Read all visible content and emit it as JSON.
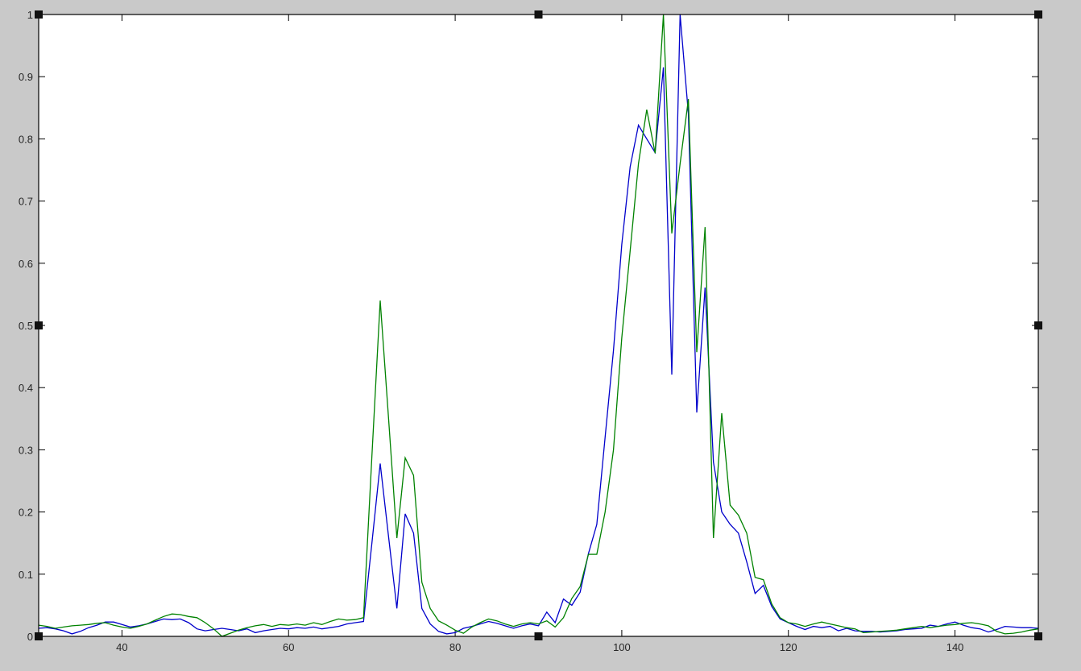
{
  "window": {
    "background_color": "#c9c9c9",
    "plot_background": "#ffffff",
    "axis_color": "#000000",
    "tick_label_color": "#262626",
    "selection_handle_color": "#111111"
  },
  "chart_data": {
    "type": "line",
    "title": "",
    "xlabel": "",
    "ylabel": "",
    "xlim": [
      30,
      150
    ],
    "ylim": [
      0,
      1
    ],
    "grid": false,
    "legend_position": "none",
    "box": true,
    "ticks_direction": "in",
    "x_ticks": [
      40,
      60,
      80,
      100,
      120,
      140
    ],
    "x_tick_labels": [
      "40",
      "60",
      "80",
      "100",
      "120",
      "140"
    ],
    "y_ticks": [
      0,
      0.1,
      0.2,
      0.3,
      0.4,
      0.5,
      0.6,
      0.7,
      0.8,
      0.9,
      1
    ],
    "y_tick_labels": [
      "0",
      "0.1",
      "0.2",
      "0.3",
      "0.4",
      "0.5",
      "0.6",
      "0.7",
      "0.8",
      "0.9",
      "1"
    ],
    "selection_handles": true,
    "series": [
      {
        "name": "blue-line",
        "color": "#0000cb",
        "points": [
          [
            30,
            0.013
          ],
          [
            31,
            0.014
          ],
          [
            32,
            0.012
          ],
          [
            33,
            0.009
          ],
          [
            34,
            0.004
          ],
          [
            35,
            0.008
          ],
          [
            36,
            0.014
          ],
          [
            37,
            0.018
          ],
          [
            38,
            0.023
          ],
          [
            39,
            0.023
          ],
          [
            40,
            0.019
          ],
          [
            41,
            0.015
          ],
          [
            42,
            0.017
          ],
          [
            43,
            0.02
          ],
          [
            44,
            0.024
          ],
          [
            45,
            0.028
          ],
          [
            46,
            0.027
          ],
          [
            47,
            0.028
          ],
          [
            48,
            0.022
          ],
          [
            49,
            0.012
          ],
          [
            50,
            0.009
          ],
          [
            51,
            0.011
          ],
          [
            52,
            0.013
          ],
          [
            53,
            0.011
          ],
          [
            54,
            0.009
          ],
          [
            55,
            0.012
          ],
          [
            56,
            0.006
          ],
          [
            57,
            0.009
          ],
          [
            58,
            0.011
          ],
          [
            59,
            0.013
          ],
          [
            60,
            0.012
          ],
          [
            61,
            0.014
          ],
          [
            62,
            0.013
          ],
          [
            63,
            0.015
          ],
          [
            64,
            0.012
          ],
          [
            65,
            0.014
          ],
          [
            66,
            0.016
          ],
          [
            67,
            0.02
          ],
          [
            68,
            0.022
          ],
          [
            69,
            0.024
          ],
          [
            70,
            0.15
          ],
          [
            71,
            0.278
          ],
          [
            72,
            0.16
          ],
          [
            73,
            0.045
          ],
          [
            74,
            0.197
          ],
          [
            75,
            0.166
          ],
          [
            76,
            0.045
          ],
          [
            77,
            0.02
          ],
          [
            78,
            0.008
          ],
          [
            79,
            0.004
          ],
          [
            80,
            0.006
          ],
          [
            81,
            0.013
          ],
          [
            82,
            0.016
          ],
          [
            83,
            0.02
          ],
          [
            84,
            0.024
          ],
          [
            85,
            0.021
          ],
          [
            86,
            0.017
          ],
          [
            87,
            0.013
          ],
          [
            88,
            0.017
          ],
          [
            89,
            0.02
          ],
          [
            90,
            0.017
          ],
          [
            91,
            0.039
          ],
          [
            92,
            0.022
          ],
          [
            93,
            0.06
          ],
          [
            94,
            0.05
          ],
          [
            95,
            0.071
          ],
          [
            96,
            0.133
          ],
          [
            97,
            0.18
          ],
          [
            98,
            0.32
          ],
          [
            99,
            0.46
          ],
          [
            100,
            0.63
          ],
          [
            101,
            0.755
          ],
          [
            102,
            0.822
          ],
          [
            103,
            0.8
          ],
          [
            104,
            0.778
          ],
          [
            105,
            0.915
          ],
          [
            106,
            0.421
          ],
          [
            107,
            1.0
          ],
          [
            108,
            0.84
          ],
          [
            109,
            0.36
          ],
          [
            110,
            0.561
          ],
          [
            111,
            0.28
          ],
          [
            112,
            0.2
          ],
          [
            113,
            0.18
          ],
          [
            114,
            0.166
          ],
          [
            115,
            0.12
          ],
          [
            116,
            0.069
          ],
          [
            117,
            0.082
          ],
          [
            118,
            0.048
          ],
          [
            119,
            0.028
          ],
          [
            120,
            0.022
          ],
          [
            121,
            0.016
          ],
          [
            122,
            0.011
          ],
          [
            123,
            0.016
          ],
          [
            124,
            0.014
          ],
          [
            125,
            0.016
          ],
          [
            126,
            0.009
          ],
          [
            127,
            0.013
          ],
          [
            128,
            0.009
          ],
          [
            129,
            0.008
          ],
          [
            130,
            0.008
          ],
          [
            131,
            0.007
          ],
          [
            132,
            0.008
          ],
          [
            133,
            0.009
          ],
          [
            134,
            0.011
          ],
          [
            135,
            0.012
          ],
          [
            136,
            0.013
          ],
          [
            137,
            0.018
          ],
          [
            138,
            0.016
          ],
          [
            139,
            0.02
          ],
          [
            140,
            0.023
          ],
          [
            141,
            0.018
          ],
          [
            142,
            0.014
          ],
          [
            143,
            0.012
          ],
          [
            144,
            0.007
          ],
          [
            145,
            0.011
          ],
          [
            146,
            0.016
          ],
          [
            147,
            0.015
          ],
          [
            148,
            0.014
          ],
          [
            149,
            0.014
          ],
          [
            150,
            0.013
          ]
        ]
      },
      {
        "name": "green-line",
        "color": "#008200",
        "points": [
          [
            30,
            0.018
          ],
          [
            31,
            0.016
          ],
          [
            32,
            0.013
          ],
          [
            33,
            0.015
          ],
          [
            34,
            0.017
          ],
          [
            35,
            0.018
          ],
          [
            36,
            0.019
          ],
          [
            37,
            0.021
          ],
          [
            38,
            0.022
          ],
          [
            39,
            0.018
          ],
          [
            40,
            0.015
          ],
          [
            41,
            0.013
          ],
          [
            42,
            0.016
          ],
          [
            43,
            0.02
          ],
          [
            44,
            0.026
          ],
          [
            45,
            0.032
          ],
          [
            46,
            0.036
          ],
          [
            47,
            0.035
          ],
          [
            48,
            0.032
          ],
          [
            49,
            0.03
          ],
          [
            50,
            0.022
          ],
          [
            51,
            0.012
          ],
          [
            52,
            0.0
          ],
          [
            53,
            0.005
          ],
          [
            54,
            0.01
          ],
          [
            55,
            0.014
          ],
          [
            56,
            0.017
          ],
          [
            57,
            0.019
          ],
          [
            58,
            0.016
          ],
          [
            59,
            0.019
          ],
          [
            60,
            0.018
          ],
          [
            61,
            0.02
          ],
          [
            62,
            0.018
          ],
          [
            63,
            0.022
          ],
          [
            64,
            0.019
          ],
          [
            65,
            0.024
          ],
          [
            66,
            0.028
          ],
          [
            67,
            0.026
          ],
          [
            68,
            0.027
          ],
          [
            69,
            0.03
          ],
          [
            70,
            0.29
          ],
          [
            71,
            0.54
          ],
          [
            72,
            0.35
          ],
          [
            73,
            0.158
          ],
          [
            74,
            0.287
          ],
          [
            75,
            0.259
          ],
          [
            76,
            0.087
          ],
          [
            77,
            0.045
          ],
          [
            78,
            0.025
          ],
          [
            79,
            0.018
          ],
          [
            80,
            0.01
          ],
          [
            81,
            0.005
          ],
          [
            82,
            0.015
          ],
          [
            83,
            0.022
          ],
          [
            84,
            0.028
          ],
          [
            85,
            0.025
          ],
          [
            86,
            0.02
          ],
          [
            87,
            0.016
          ],
          [
            88,
            0.02
          ],
          [
            89,
            0.022
          ],
          [
            90,
            0.02
          ],
          [
            91,
            0.025
          ],
          [
            92,
            0.015
          ],
          [
            93,
            0.03
          ],
          [
            94,
            0.061
          ],
          [
            95,
            0.08
          ],
          [
            96,
            0.132
          ],
          [
            97,
            0.132
          ],
          [
            98,
            0.2
          ],
          [
            99,
            0.3
          ],
          [
            100,
            0.48
          ],
          [
            101,
            0.62
          ],
          [
            102,
            0.76
          ],
          [
            103,
            0.847
          ],
          [
            104,
            0.777
          ],
          [
            105,
            1.0
          ],
          [
            106,
            0.648
          ],
          [
            107,
            0.76
          ],
          [
            108,
            0.864
          ],
          [
            109,
            0.457
          ],
          [
            110,
            0.658
          ],
          [
            111,
            0.158
          ],
          [
            112,
            0.359
          ],
          [
            113,
            0.211
          ],
          [
            114,
            0.195
          ],
          [
            115,
            0.166
          ],
          [
            116,
            0.095
          ],
          [
            117,
            0.091
          ],
          [
            118,
            0.052
          ],
          [
            119,
            0.03
          ],
          [
            120,
            0.022
          ],
          [
            121,
            0.02
          ],
          [
            122,
            0.016
          ],
          [
            123,
            0.02
          ],
          [
            124,
            0.023
          ],
          [
            125,
            0.02
          ],
          [
            126,
            0.017
          ],
          [
            127,
            0.014
          ],
          [
            128,
            0.012
          ],
          [
            129,
            0.006
          ],
          [
            130,
            0.007
          ],
          [
            131,
            0.008
          ],
          [
            132,
            0.009
          ],
          [
            133,
            0.01
          ],
          [
            134,
            0.012
          ],
          [
            135,
            0.014
          ],
          [
            136,
            0.016
          ],
          [
            137,
            0.014
          ],
          [
            138,
            0.016
          ],
          [
            139,
            0.018
          ],
          [
            140,
            0.019
          ],
          [
            141,
            0.021
          ],
          [
            142,
            0.022
          ],
          [
            143,
            0.02
          ],
          [
            144,
            0.017
          ],
          [
            145,
            0.008
          ],
          [
            146,
            0.004
          ],
          [
            147,
            0.005
          ],
          [
            148,
            0.007
          ],
          [
            149,
            0.01
          ],
          [
            150,
            0.012
          ]
        ]
      }
    ]
  },
  "layout_note": ""
}
